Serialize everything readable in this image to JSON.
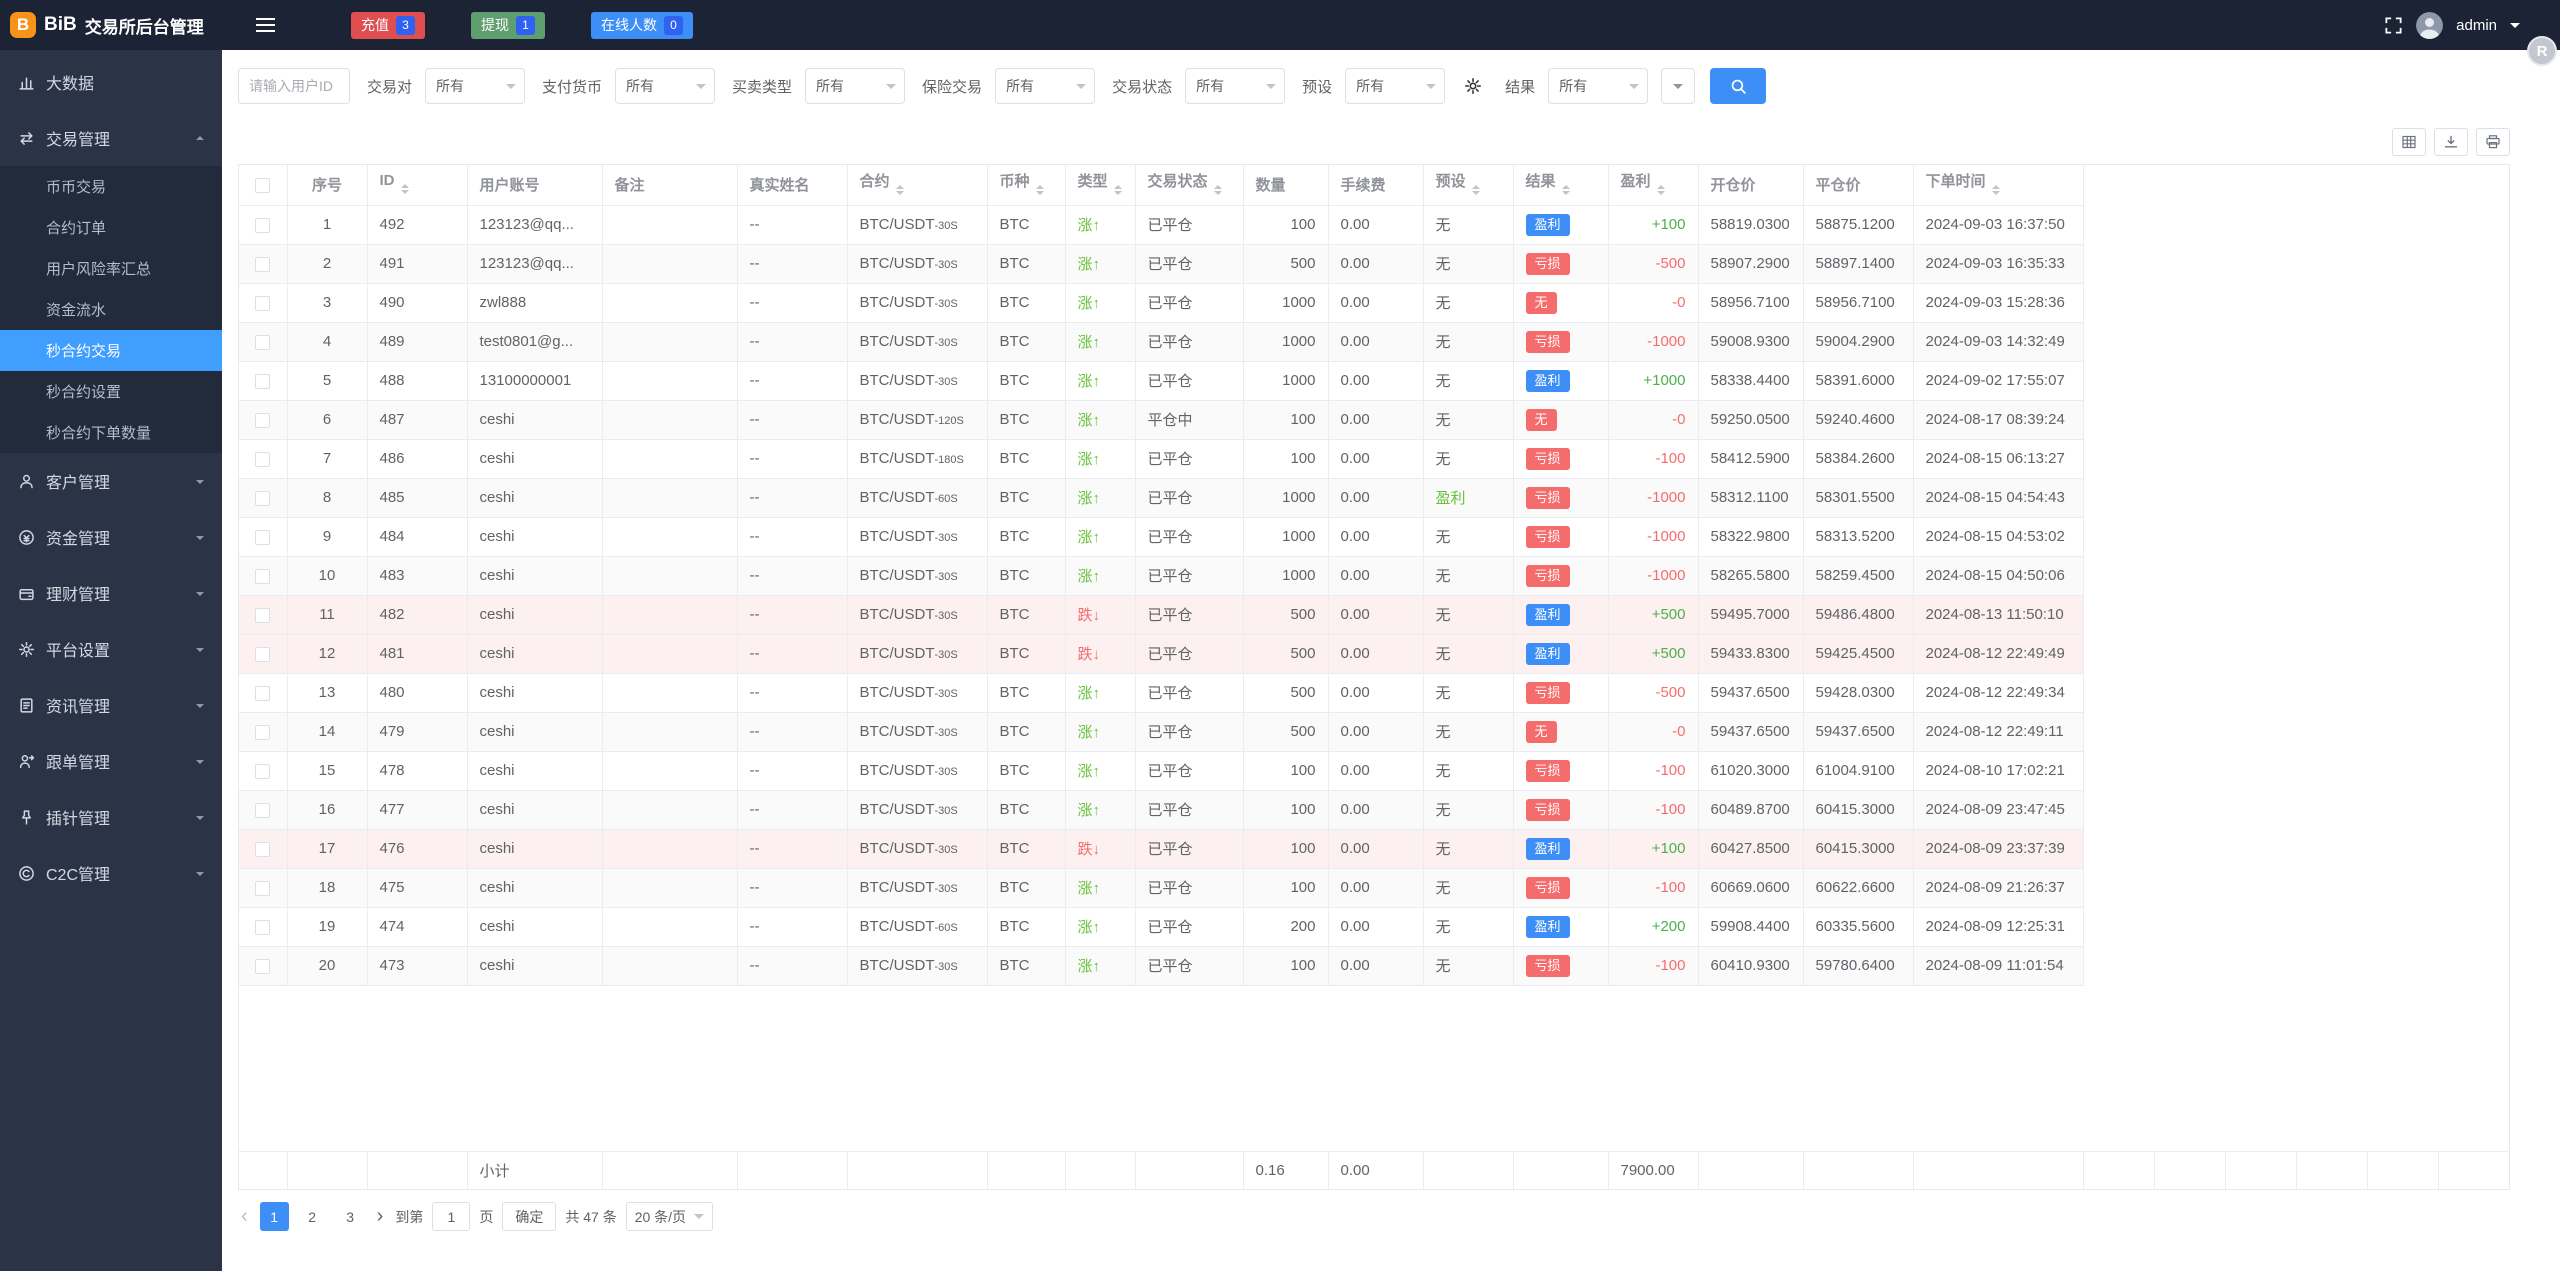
{
  "app": {
    "logo": "BiB",
    "title": "交易所后台管理",
    "user": "admin",
    "float_badge": "R"
  },
  "colors": {
    "accent": "#409eff",
    "success": "#67c23a",
    "danger": "#f56c6c",
    "header_bg": "#1b2335",
    "sidebar_bg": "#2b3446"
  },
  "header": {
    "quick_buttons": [
      {
        "key": "recharge",
        "label": "充值",
        "badge": "3"
      },
      {
        "key": "withdraw",
        "label": "提现",
        "badge": "1"
      },
      {
        "key": "online",
        "label": "在线人数",
        "badge": "0"
      }
    ]
  },
  "sidebar": {
    "items": [
      {
        "label": "大数据",
        "icon": "chart-icon",
        "type": "single"
      },
      {
        "label": "交易管理",
        "icon": "exchange-icon",
        "type": "group",
        "expanded": true,
        "children": [
          {
            "label": "币币交易"
          },
          {
            "label": "合约订单"
          },
          {
            "label": "用户风险率汇总"
          },
          {
            "label": "资金流水"
          },
          {
            "label": "秒合约交易",
            "active": true
          },
          {
            "label": "秒合约设置"
          },
          {
            "label": "秒合约下单数量"
          }
        ]
      },
      {
        "label": "客户管理",
        "icon": "customer-icon",
        "type": "group"
      },
      {
        "label": "资金管理",
        "icon": "funds-icon",
        "type": "group"
      },
      {
        "label": "理财管理",
        "icon": "finance-icon",
        "type": "group"
      },
      {
        "label": "平台设置",
        "icon": "settings-icon",
        "type": "group"
      },
      {
        "label": "资讯管理",
        "icon": "news-icon",
        "type": "group"
      },
      {
        "label": "跟单管理",
        "icon": "follow-icon",
        "type": "group"
      },
      {
        "label": "插针管理",
        "icon": "pin-icon",
        "type": "group"
      },
      {
        "label": "C2C管理",
        "icon": "c2c-icon",
        "type": "group"
      }
    ]
  },
  "filters": {
    "user_id_placeholder": "请输入用户ID",
    "selects": [
      {
        "label": "交易对",
        "value": "所有"
      },
      {
        "label": "支付货币",
        "value": "所有"
      },
      {
        "label": "买卖类型",
        "value": "所有"
      },
      {
        "label": "保险交易",
        "value": "所有"
      },
      {
        "label": "交易状态",
        "value": "所有"
      },
      {
        "label": "预设",
        "value": "所有"
      }
    ],
    "result": {
      "label": "结果",
      "value": "所有"
    }
  },
  "table": {
    "columns": [
      {
        "label": "序号",
        "sortable": false
      },
      {
        "label": "ID",
        "sortable": true
      },
      {
        "label": "用户账号",
        "sortable": false
      },
      {
        "label": "备注",
        "sortable": false
      },
      {
        "label": "真实姓名",
        "sortable": false
      },
      {
        "label": "合约",
        "sortable": true
      },
      {
        "label": "币种",
        "sortable": true
      },
      {
        "label": "类型",
        "sortable": true
      },
      {
        "label": "交易状态",
        "sortable": true
      },
      {
        "label": "数量",
        "sortable": false
      },
      {
        "label": "手续费",
        "sortable": false
      },
      {
        "label": "预设",
        "sortable": true
      },
      {
        "label": "结果",
        "sortable": true
      },
      {
        "label": "盈利",
        "sortable": true
      },
      {
        "label": "开仓价",
        "sortable": false
      },
      {
        "label": "平仓价",
        "sortable": false
      },
      {
        "label": "下单时间",
        "sortable": true
      }
    ],
    "rows": [
      {
        "seq": "1",
        "id": "492",
        "account": "123123@qq...",
        "note": "",
        "real_name": "--",
        "contract": "BTC/USDT",
        "period": "30S",
        "coin": "BTC",
        "type": "涨",
        "direction": "up",
        "status": "已平仓",
        "amount": "100",
        "fee": "0.00",
        "preset": "无",
        "preset_style": "plain",
        "result": "盈利",
        "result_style": "win",
        "profit": "+100",
        "profit_style": "pos",
        "open_price": "58819.0300",
        "close_price": "58875.1200",
        "time": "2024-09-03 16:37:50"
      },
      {
        "seq": "2",
        "id": "491",
        "account": "123123@qq...",
        "note": "",
        "real_name": "--",
        "contract": "BTC/USDT",
        "period": "30S",
        "coin": "BTC",
        "type": "涨",
        "direction": "up",
        "status": "已平仓",
        "amount": "500",
        "fee": "0.00",
        "preset": "无",
        "preset_style": "plain",
        "result": "亏损",
        "result_style": "loss",
        "profit": "-500",
        "profit_style": "neg",
        "open_price": "58907.2900",
        "close_price": "58897.1400",
        "time": "2024-09-03 16:35:33"
      },
      {
        "seq": "3",
        "id": "490",
        "account": "zwl888",
        "note": "",
        "real_name": "--",
        "contract": "BTC/USDT",
        "period": "30S",
        "coin": "BTC",
        "type": "涨",
        "direction": "up",
        "status": "已平仓",
        "amount": "1000",
        "fee": "0.00",
        "preset": "无",
        "preset_style": "plain",
        "result": "无",
        "result_style": "none",
        "profit": "-0",
        "profit_style": "neg",
        "open_price": "58956.7100",
        "close_price": "58956.7100",
        "time": "2024-09-03 15:28:36"
      },
      {
        "seq": "4",
        "id": "489",
        "account": "test0801@g...",
        "note": "",
        "real_name": "--",
        "contract": "BTC/USDT",
        "period": "30S",
        "coin": "BTC",
        "type": "涨",
        "direction": "up",
        "status": "已平仓",
        "amount": "1000",
        "fee": "0.00",
        "preset": "无",
        "preset_style": "plain",
        "result": "亏损",
        "result_style": "loss",
        "profit": "-1000",
        "profit_style": "neg",
        "open_price": "59008.9300",
        "close_price": "59004.2900",
        "time": "2024-09-03 14:32:49"
      },
      {
        "seq": "5",
        "id": "488",
        "account": "13100000001",
        "note": "",
        "real_name": "--",
        "contract": "BTC/USDT",
        "period": "30S",
        "coin": "BTC",
        "type": "涨",
        "direction": "up",
        "status": "已平仓",
        "amount": "1000",
        "fee": "0.00",
        "preset": "无",
        "preset_style": "plain",
        "result": "盈利",
        "result_style": "win",
        "profit": "+1000",
        "profit_style": "pos",
        "open_price": "58338.4400",
        "close_price": "58391.6000",
        "time": "2024-09-02 17:55:07"
      },
      {
        "seq": "6",
        "id": "487",
        "account": "ceshi",
        "note": "",
        "real_name": "--",
        "contract": "BTC/USDT",
        "period": "120S",
        "coin": "BTC",
        "type": "涨",
        "direction": "up",
        "status": "平仓中",
        "amount": "100",
        "fee": "0.00",
        "preset": "无",
        "preset_style": "plain",
        "result": "无",
        "result_style": "none",
        "profit": "-0",
        "profit_style": "neg",
        "open_price": "59250.0500",
        "close_price": "59240.4600",
        "time": "2024-08-17 08:39:24"
      },
      {
        "seq": "7",
        "id": "486",
        "account": "ceshi",
        "note": "",
        "real_name": "--",
        "contract": "BTC/USDT",
        "period": "180S",
        "coin": "BTC",
        "type": "涨",
        "direction": "up",
        "status": "已平仓",
        "amount": "100",
        "fee": "0.00",
        "preset": "无",
        "preset_style": "plain",
        "result": "亏损",
        "result_style": "loss",
        "profit": "-100",
        "profit_style": "neg",
        "open_price": "58412.5900",
        "close_price": "58384.2600",
        "time": "2024-08-15 06:13:27"
      },
      {
        "seq": "8",
        "id": "485",
        "account": "ceshi",
        "note": "",
        "real_name": "--",
        "contract": "BTC/USDT",
        "period": "60S",
        "coin": "BTC",
        "type": "涨",
        "direction": "up",
        "status": "已平仓",
        "amount": "1000",
        "fee": "0.00",
        "preset": "盈利",
        "preset_style": "win-text",
        "result": "亏损",
        "result_style": "loss",
        "profit": "-1000",
        "profit_style": "neg",
        "open_price": "58312.1100",
        "close_price": "58301.5500",
        "time": "2024-08-15 04:54:43"
      },
      {
        "seq": "9",
        "id": "484",
        "account": "ceshi",
        "note": "",
        "real_name": "--",
        "contract": "BTC/USDT",
        "period": "30S",
        "coin": "BTC",
        "type": "涨",
        "direction": "up",
        "status": "已平仓",
        "amount": "1000",
        "fee": "0.00",
        "preset": "无",
        "preset_style": "plain",
        "result": "亏损",
        "result_style": "loss",
        "profit": "-1000",
        "profit_style": "neg",
        "open_price": "58322.9800",
        "close_price": "58313.5200",
        "time": "2024-08-15 04:53:02"
      },
      {
        "seq": "10",
        "id": "483",
        "account": "ceshi",
        "note": "",
        "real_name": "--",
        "contract": "BTC/USDT",
        "period": "30S",
        "coin": "BTC",
        "type": "涨",
        "direction": "up",
        "status": "已平仓",
        "amount": "1000",
        "fee": "0.00",
        "preset": "无",
        "preset_style": "plain",
        "result": "亏损",
        "result_style": "loss",
        "profit": "-1000",
        "profit_style": "neg",
        "open_price": "58265.5800",
        "close_price": "58259.4500",
        "time": "2024-08-15 04:50:06"
      },
      {
        "seq": "11",
        "id": "482",
        "account": "ceshi",
        "note": "",
        "real_name": "--",
        "contract": "BTC/USDT",
        "period": "30S",
        "coin": "BTC",
        "type": "跌",
        "direction": "down",
        "status": "已平仓",
        "amount": "500",
        "fee": "0.00",
        "preset": "无",
        "preset_style": "plain",
        "result": "盈利",
        "result_style": "win",
        "profit": "+500",
        "profit_style": "pos",
        "open_price": "59495.7000",
        "close_price": "59486.4800",
        "time": "2024-08-13 11:50:10"
      },
      {
        "seq": "12",
        "id": "481",
        "account": "ceshi",
        "note": "",
        "real_name": "--",
        "contract": "BTC/USDT",
        "period": "30S",
        "coin": "BTC",
        "type": "跌",
        "direction": "down",
        "status": "已平仓",
        "amount": "500",
        "fee": "0.00",
        "preset": "无",
        "preset_style": "plain",
        "result": "盈利",
        "result_style": "win",
        "profit": "+500",
        "profit_style": "pos",
        "open_price": "59433.8300",
        "close_price": "59425.4500",
        "time": "2024-08-12 22:49:49"
      },
      {
        "seq": "13",
        "id": "480",
        "account": "ceshi",
        "note": "",
        "real_name": "--",
        "contract": "BTC/USDT",
        "period": "30S",
        "coin": "BTC",
        "type": "涨",
        "direction": "up",
        "status": "已平仓",
        "amount": "500",
        "fee": "0.00",
        "preset": "无",
        "preset_style": "plain",
        "result": "亏损",
        "result_style": "loss",
        "profit": "-500",
        "profit_style": "neg",
        "open_price": "59437.6500",
        "close_price": "59428.0300",
        "time": "2024-08-12 22:49:34"
      },
      {
        "seq": "14",
        "id": "479",
        "account": "ceshi",
        "note": "",
        "real_name": "--",
        "contract": "BTC/USDT",
        "period": "30S",
        "coin": "BTC",
        "type": "涨",
        "direction": "up",
        "status": "已平仓",
        "amount": "500",
        "fee": "0.00",
        "preset": "无",
        "preset_style": "plain",
        "result": "无",
        "result_style": "none",
        "profit": "-0",
        "profit_style": "neg",
        "open_price": "59437.6500",
        "close_price": "59437.6500",
        "time": "2024-08-12 22:49:11"
      },
      {
        "seq": "15",
        "id": "478",
        "account": "ceshi",
        "note": "",
        "real_name": "--",
        "contract": "BTC/USDT",
        "period": "30S",
        "coin": "BTC",
        "type": "涨",
        "direction": "up",
        "status": "已平仓",
        "amount": "100",
        "fee": "0.00",
        "preset": "无",
        "preset_style": "plain",
        "result": "亏损",
        "result_style": "loss",
        "profit": "-100",
        "profit_style": "neg",
        "open_price": "61020.3000",
        "close_price": "61004.9100",
        "time": "2024-08-10 17:02:21"
      },
      {
        "seq": "16",
        "id": "477",
        "account": "ceshi",
        "note": "",
        "real_name": "--",
        "contract": "BTC/USDT",
        "period": "30S",
        "coin": "BTC",
        "type": "涨",
        "direction": "up",
        "status": "已平仓",
        "amount": "100",
        "fee": "0.00",
        "preset": "无",
        "preset_style": "plain",
        "result": "亏损",
        "result_style": "loss",
        "profit": "-100",
        "profit_style": "neg",
        "open_price": "60489.8700",
        "close_price": "60415.3000",
        "time": "2024-08-09 23:47:45"
      },
      {
        "seq": "17",
        "id": "476",
        "account": "ceshi",
        "note": "",
        "real_name": "--",
        "contract": "BTC/USDT",
        "period": "30S",
        "coin": "BTC",
        "type": "跌",
        "direction": "down",
        "status": "已平仓",
        "amount": "100",
        "fee": "0.00",
        "preset": "无",
        "preset_style": "plain",
        "result": "盈利",
        "result_style": "win",
        "profit": "+100",
        "profit_style": "pos",
        "open_price": "60427.8500",
        "close_price": "60415.3000",
        "time": "2024-08-09 23:37:39"
      },
      {
        "seq": "18",
        "id": "475",
        "account": "ceshi",
        "note": "",
        "real_name": "--",
        "contract": "BTC/USDT",
        "period": "30S",
        "coin": "BTC",
        "type": "涨",
        "direction": "up",
        "status": "已平仓",
        "amount": "100",
        "fee": "0.00",
        "preset": "无",
        "preset_style": "plain",
        "result": "亏损",
        "result_style": "loss",
        "profit": "-100",
        "profit_style": "neg",
        "open_price": "60669.0600",
        "close_price": "60622.6600",
        "time": "2024-08-09 21:26:37"
      },
      {
        "seq": "19",
        "id": "474",
        "account": "ceshi",
        "note": "",
        "real_name": "--",
        "contract": "BTC/USDT",
        "period": "60S",
        "coin": "BTC",
        "type": "涨",
        "direction": "up",
        "status": "已平仓",
        "amount": "200",
        "fee": "0.00",
        "preset": "无",
        "preset_style": "plain",
        "result": "盈利",
        "result_style": "win",
        "profit": "+200",
        "profit_style": "pos",
        "open_price": "59908.4400",
        "close_price": "60335.5600",
        "time": "2024-08-09 12:25:31"
      },
      {
        "seq": "20",
        "id": "473",
        "account": "ceshi",
        "note": "",
        "real_name": "--",
        "contract": "BTC/USDT",
        "period": "30S",
        "coin": "BTC",
        "type": "涨",
        "direction": "up",
        "status": "已平仓",
        "amount": "100",
        "fee": "0.00",
        "preset": "无",
        "preset_style": "plain",
        "result": "亏损",
        "result_style": "loss",
        "profit": "-100",
        "profit_style": "neg",
        "open_price": "60410.9300",
        "close_price": "59780.6400",
        "time": "2024-08-09 11:01:54"
      }
    ],
    "footer": {
      "label": "小计",
      "amount_total": "0.16",
      "fee_total": "0.00",
      "profit_total": "7900.00"
    }
  },
  "pagination": {
    "prev": "‹",
    "next": "›",
    "pages": [
      "1",
      "2",
      "3"
    ],
    "active_page": "1",
    "jump_prefix": "到第",
    "jump_value": "1",
    "jump_suffix": "页",
    "confirm_label": "确定",
    "total_label": "共 47 条",
    "per_page": "20 条/页"
  }
}
